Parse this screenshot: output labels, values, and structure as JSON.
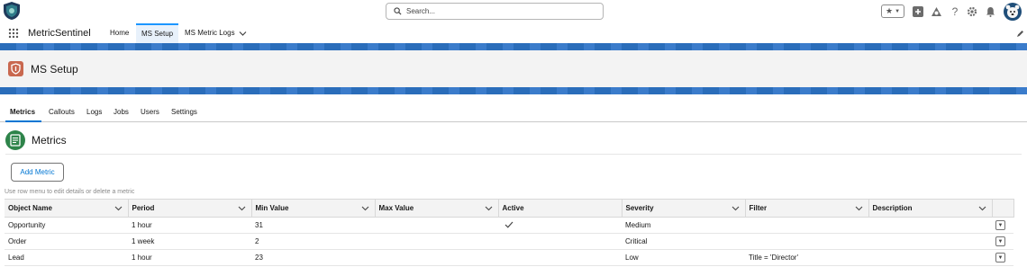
{
  "search": {
    "placeholder": "Search..."
  },
  "app": {
    "name": "MetricSentinel"
  },
  "nav_tabs": [
    {
      "label": "Home"
    },
    {
      "label": "MS Setup"
    },
    {
      "label": "MS Metric Logs"
    }
  ],
  "page": {
    "title": "MS Setup"
  },
  "sub_tabs": [
    {
      "label": "Metrics"
    },
    {
      "label": "Callouts"
    },
    {
      "label": "Logs"
    },
    {
      "label": "Jobs"
    },
    {
      "label": "Users"
    },
    {
      "label": "Settings"
    }
  ],
  "section": {
    "title": "Metrics",
    "add_label": "Add Metric",
    "hint": "Use row menu to edit details or delete a metric"
  },
  "table": {
    "columns": [
      "Object Name",
      "Period",
      "Min Value",
      "Max Value",
      "Active",
      "Severity",
      "Filter",
      "Description"
    ],
    "rows": [
      {
        "object_name": "Opportunity",
        "period": "1 hour",
        "min_value": "31",
        "max_value": "",
        "active": true,
        "severity": "Medium",
        "filter": "",
        "description": ""
      },
      {
        "object_name": "Order",
        "period": "1 week",
        "min_value": "2",
        "max_value": "",
        "active": false,
        "severity": "Critical",
        "filter": "",
        "description": ""
      },
      {
        "object_name": "Lead",
        "period": "1 hour",
        "min_value": "23",
        "max_value": "",
        "active": false,
        "severity": "Low",
        "filter": "Title = 'Director'",
        "description": ""
      }
    ]
  },
  "colors": {
    "brand_blue": "#0176d3",
    "stripe": "#2a6dba",
    "setup_icon": "#c9684f",
    "metrics_icon": "#2e844a"
  },
  "icons": [
    "search-icon",
    "favorites-icon",
    "favorites-dropdown-icon",
    "global-actions-icon",
    "trailhead-icon",
    "help-icon",
    "setup-gear-icon",
    "notifications-bell-icon",
    "avatar",
    "app-launcher-icon",
    "nav-chevron-icon",
    "edit-nav-pencil-icon"
  ]
}
